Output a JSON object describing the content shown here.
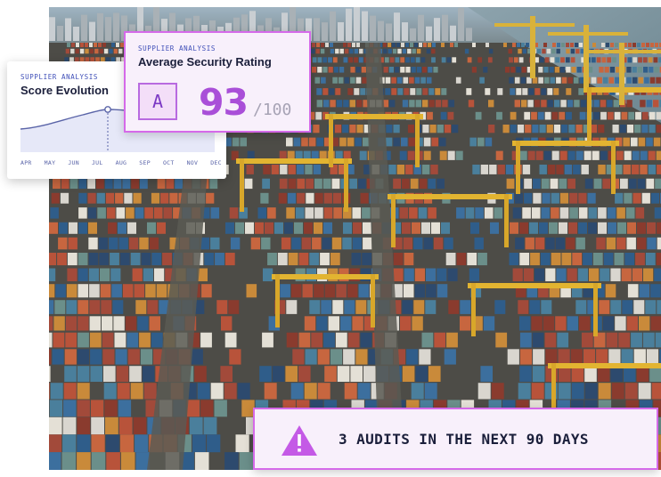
{
  "score_card": {
    "eyebrow": "SUPPLIER ANALYSIS",
    "title": "Score Evolution",
    "months": [
      "APR",
      "MAY",
      "JUN",
      "JUL",
      "AUG",
      "SEP",
      "OCT",
      "NOV",
      "DEC"
    ]
  },
  "rating_card": {
    "eyebrow": "SUPPLIER ANALYSIS",
    "title": "Average Security Rating",
    "grade": "A",
    "score": "93",
    "max": "/100"
  },
  "alert": {
    "text": "3 AUDITS IN THE NEXT 90 DAYS",
    "icon": "warning-icon"
  },
  "colors": {
    "accent": "#d56ae9",
    "score_purple": "#a94fd8",
    "chart_line": "#5a64a8",
    "chart_fill": "#e6e8f8"
  }
}
